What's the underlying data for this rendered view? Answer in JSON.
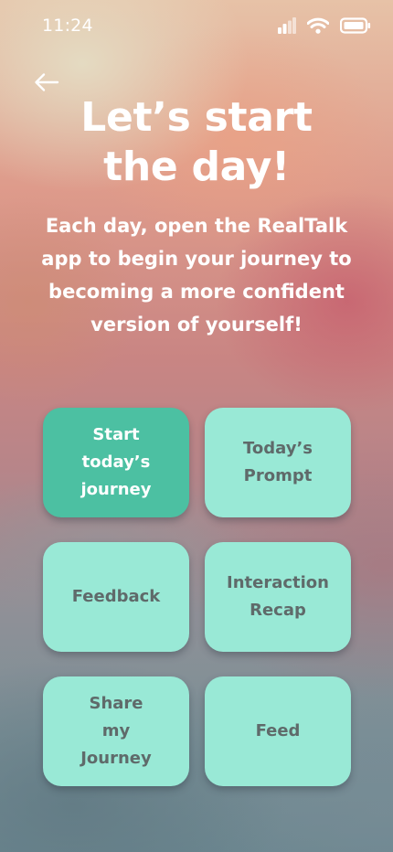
{
  "status_bar": {
    "time": "11:24"
  },
  "header": {
    "back_icon": "arrow-left-icon",
    "title_line1": "Let’s start",
    "title_line2": "the day!",
    "subtitle": "Each day, open the RealTalk app to begin your journey to becoming a more confident version of yourself!"
  },
  "tiles": [
    {
      "lines": [
        "Start",
        "today’s",
        "journey"
      ],
      "active": true
    },
    {
      "lines": [
        "Today’s",
        "Prompt"
      ],
      "active": false
    },
    {
      "lines": [
        "Feedback"
      ],
      "active": false
    },
    {
      "lines": [
        "Interaction",
        "Recap"
      ],
      "active": false
    },
    {
      "lines": [
        "Share",
        "my",
        "Journey"
      ],
      "active": false
    },
    {
      "lines": [
        "Feed"
      ],
      "active": false
    }
  ],
  "colors": {
    "tile": "#99e9d6",
    "tile_active": "#4cc0a2",
    "tile_text": "#5f6a6a",
    "tile_active_text": "#ffffff"
  }
}
